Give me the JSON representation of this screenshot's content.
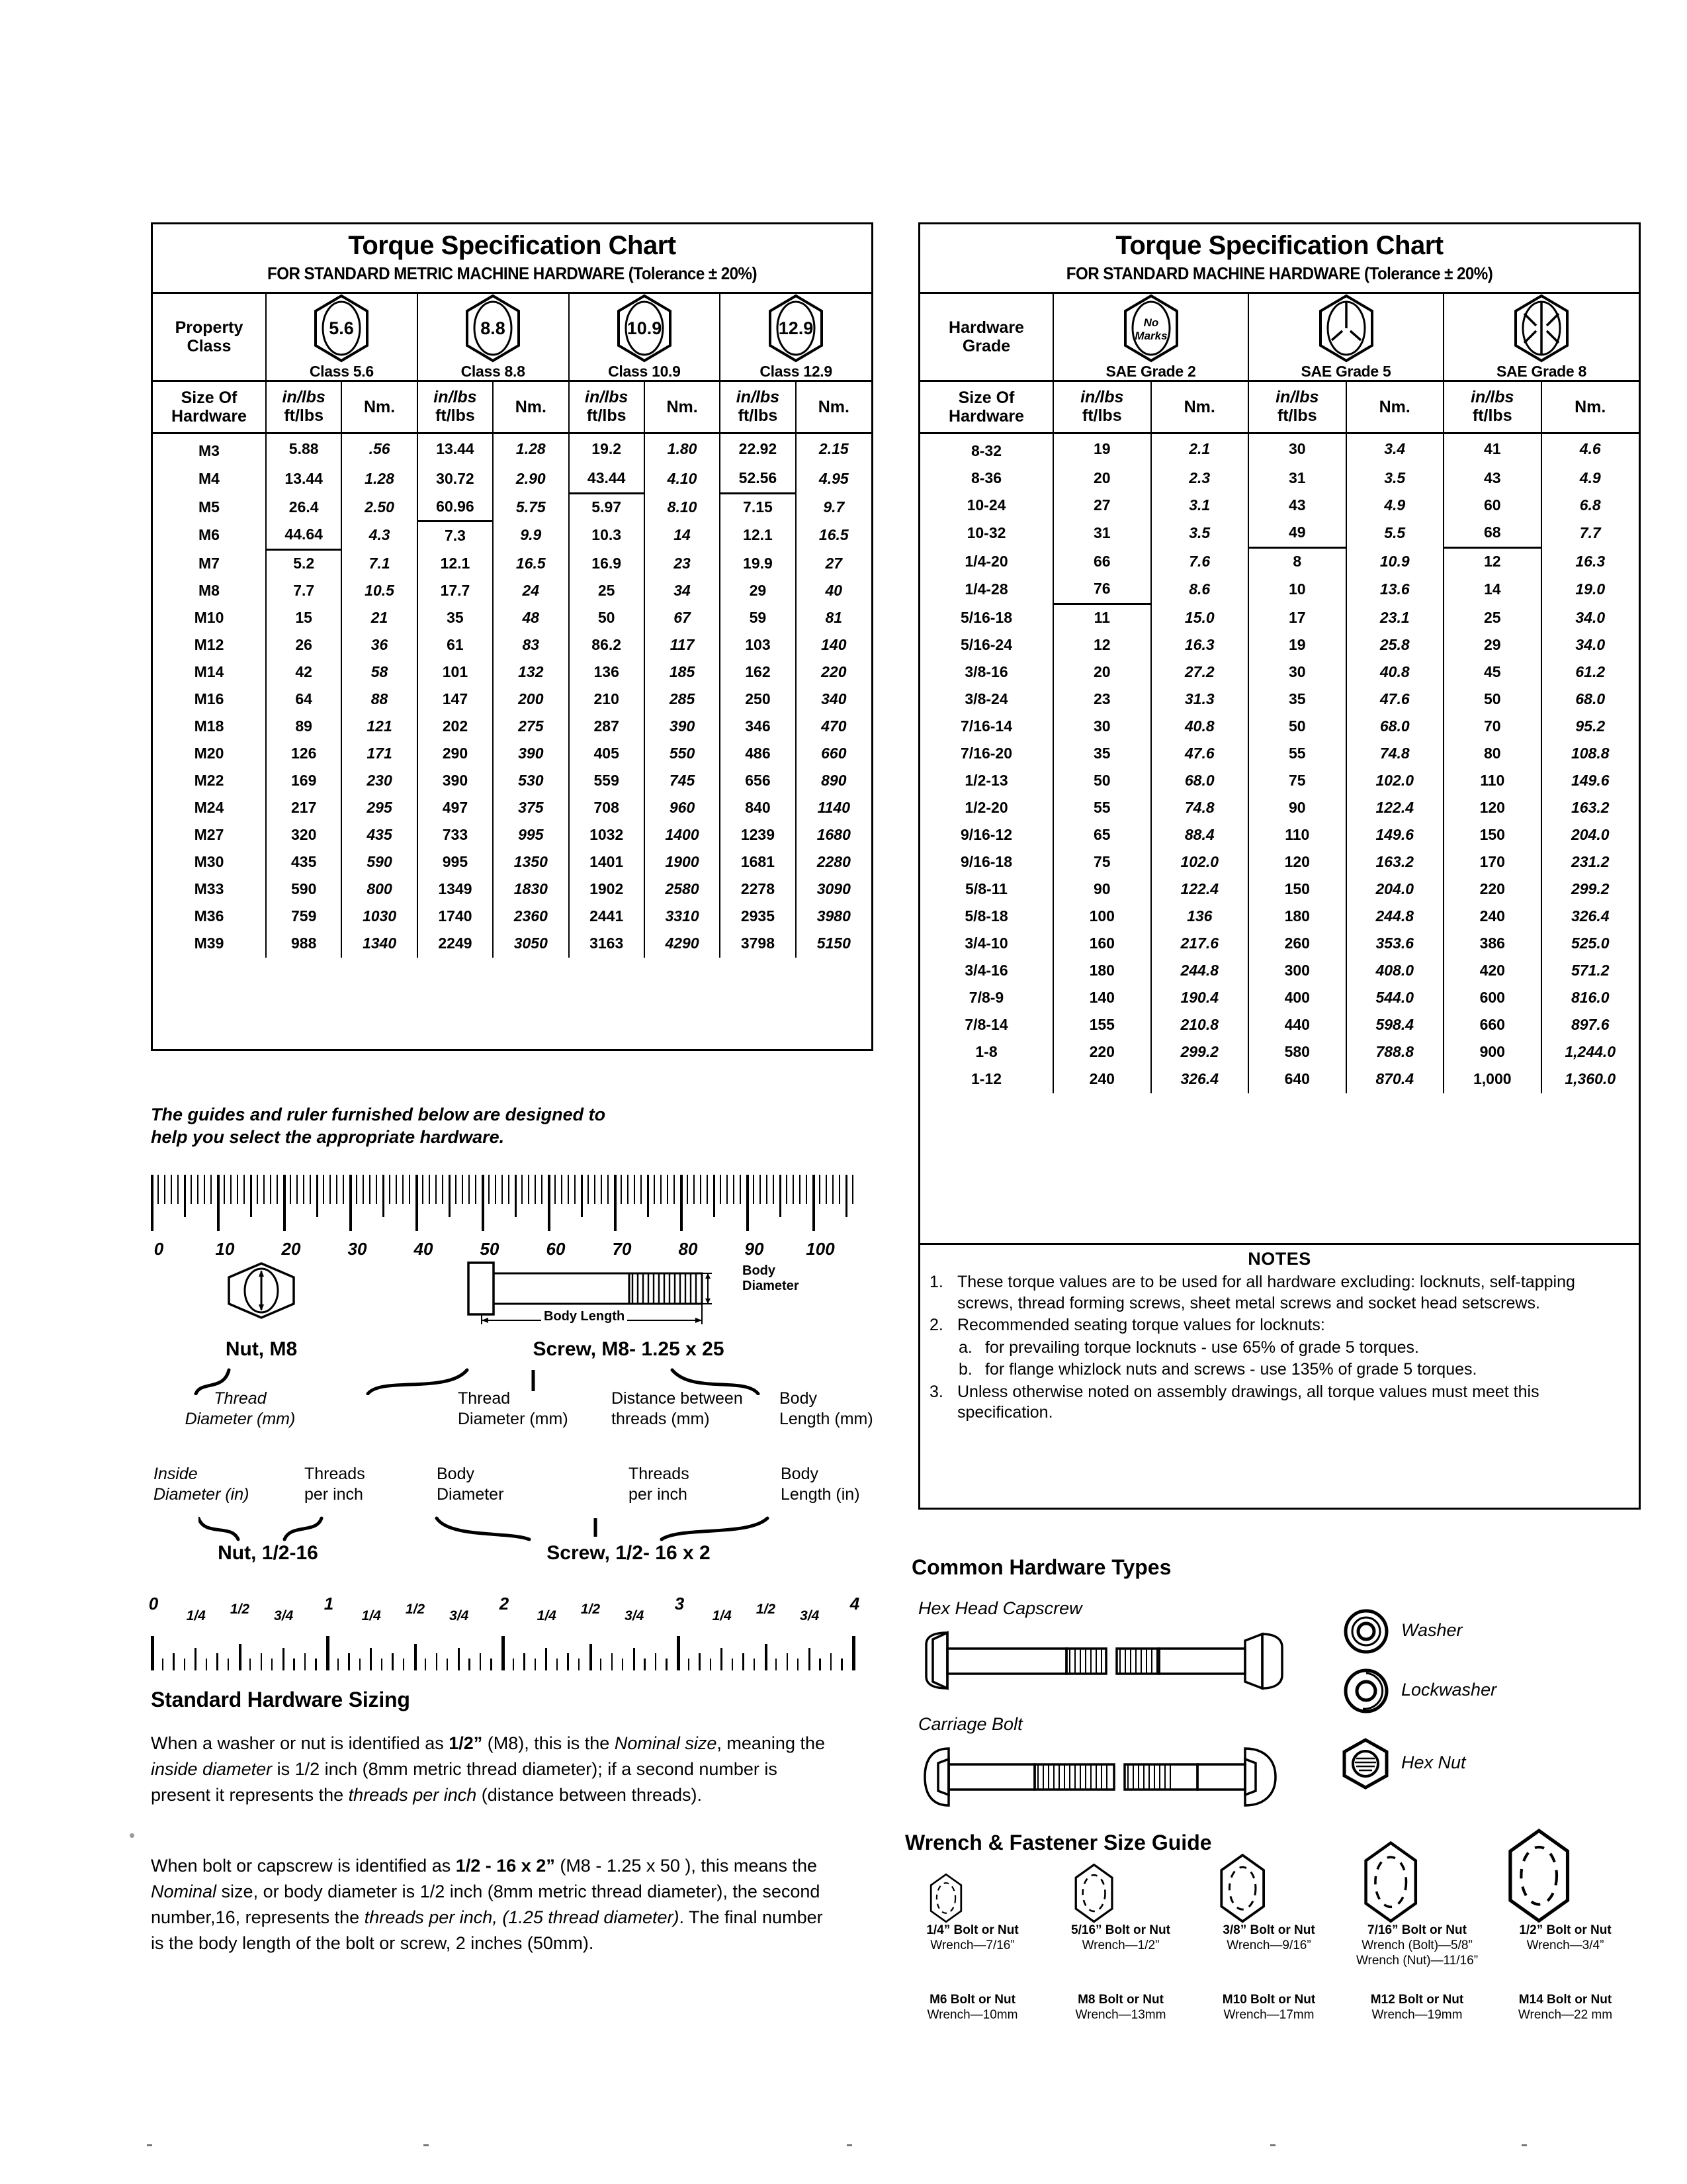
{
  "metric_chart": {
    "title": "Torque Specification Chart",
    "subtitle": "FOR STANDARD METRIC MACHINE HARDWARE (Tolerance ± 20%)",
    "grade_row_label_line1": "Property",
    "grade_row_label_line2": "Class",
    "size_label_line1": "Size Of",
    "size_label_line2": "Hardware",
    "unit_top": "in/lbs",
    "unit_bottom": "ft/lbs",
    "unit_nm": "Nm.",
    "classes": [
      {
        "mark": "5.6",
        "label": "Class 5.6"
      },
      {
        "mark": "8.8",
        "label": "Class 8.8"
      },
      {
        "mark": "10.9",
        "label": "Class 10.9"
      },
      {
        "mark": "12.9",
        "label": "Class 12.9"
      }
    ],
    "rows": [
      {
        "size": "M3",
        "v": [
          "5.88",
          ".56",
          "13.44",
          "1.28",
          "19.2",
          "1.80",
          "22.92",
          "2.15"
        ]
      },
      {
        "size": "M4",
        "v": [
          "13.44",
          "1.28",
          "30.72",
          "2.90",
          "43.44",
          "4.10",
          "52.56",
          "4.95"
        ]
      },
      {
        "size": "M5",
        "v": [
          "26.4",
          "2.50",
          "60.96",
          "5.75",
          "5.97",
          "8.10",
          "7.15",
          "9.7"
        ]
      },
      {
        "size": "M6",
        "v": [
          "44.64",
          "4.3",
          "7.3",
          "9.9",
          "10.3",
          "14",
          "12.1",
          "16.5"
        ]
      },
      {
        "size": "M7",
        "v": [
          "5.2",
          "7.1",
          "12.1",
          "16.5",
          "16.9",
          "23",
          "19.9",
          "27"
        ]
      },
      {
        "size": "M8",
        "v": [
          "7.7",
          "10.5",
          "17.7",
          "24",
          "25",
          "34",
          "29",
          "40"
        ]
      },
      {
        "size": "M10",
        "v": [
          "15",
          "21",
          "35",
          "48",
          "50",
          "67",
          "59",
          "81"
        ]
      },
      {
        "size": "M12",
        "v": [
          "26",
          "36",
          "61",
          "83",
          "86.2",
          "117",
          "103",
          "140"
        ]
      },
      {
        "size": "M14",
        "v": [
          "42",
          "58",
          "101",
          "132",
          "136",
          "185",
          "162",
          "220"
        ]
      },
      {
        "size": "M16",
        "v": [
          "64",
          "88",
          "147",
          "200",
          "210",
          "285",
          "250",
          "340"
        ]
      },
      {
        "size": "M18",
        "v": [
          "89",
          "121",
          "202",
          "275",
          "287",
          "390",
          "346",
          "470"
        ]
      },
      {
        "size": "M20",
        "v": [
          "126",
          "171",
          "290",
          "390",
          "405",
          "550",
          "486",
          "660"
        ]
      },
      {
        "size": "M22",
        "v": [
          "169",
          "230",
          "390",
          "530",
          "559",
          "745",
          "656",
          "890"
        ]
      },
      {
        "size": "M24",
        "v": [
          "217",
          "295",
          "497",
          "375",
          "708",
          "960",
          "840",
          "1140"
        ]
      },
      {
        "size": "M27",
        "v": [
          "320",
          "435",
          "733",
          "995",
          "1032",
          "1400",
          "1239",
          "1680"
        ]
      },
      {
        "size": "M30",
        "v": [
          "435",
          "590",
          "995",
          "1350",
          "1401",
          "1900",
          "1681",
          "2280"
        ]
      },
      {
        "size": "M33",
        "v": [
          "590",
          "800",
          "1349",
          "1830",
          "1902",
          "2580",
          "2278",
          "3090"
        ]
      },
      {
        "size": "M36",
        "v": [
          "759",
          "1030",
          "1740",
          "2360",
          "2441",
          "3310",
          "2935",
          "3980"
        ]
      },
      {
        "size": "M39",
        "v": [
          "988",
          "1340",
          "2249",
          "3050",
          "3163",
          "4290",
          "3798",
          "5150"
        ]
      }
    ],
    "unit_break_after_row": [
      3,
      2,
      1,
      1
    ]
  },
  "sae_chart": {
    "title": "Torque Specification Chart",
    "subtitle": "FOR STANDARD MACHINE HARDWARE (Tolerance ± 20%)",
    "grade_row_label_line1": "Hardware",
    "grade_row_label_line2": "Grade",
    "size_label_line1": "Size Of",
    "size_label_line2": "Hardware",
    "unit_top": "in/lbs",
    "unit_bottom": "ft/lbs",
    "unit_nm": "Nm.",
    "grades": [
      {
        "mark": "No Marks",
        "label": "SAE Grade 2"
      },
      {
        "mark": "",
        "label": "SAE Grade 5"
      },
      {
        "mark": "",
        "label": "SAE Grade 8"
      }
    ],
    "rows": [
      {
        "size": "8-32",
        "v": [
          "19",
          "2.1",
          "30",
          "3.4",
          "41",
          "4.6"
        ]
      },
      {
        "size": "8-36",
        "v": [
          "20",
          "2.3",
          "31",
          "3.5",
          "43",
          "4.9"
        ]
      },
      {
        "size": "10-24",
        "v": [
          "27",
          "3.1",
          "43",
          "4.9",
          "60",
          "6.8"
        ]
      },
      {
        "size": "10-32",
        "v": [
          "31",
          "3.5",
          "49",
          "5.5",
          "68",
          "7.7"
        ]
      },
      {
        "size": "1/4-20",
        "v": [
          "66",
          "7.6",
          "8",
          "10.9",
          "12",
          "16.3"
        ]
      },
      {
        "size": "1/4-28",
        "v": [
          "76",
          "8.6",
          "10",
          "13.6",
          "14",
          "19.0"
        ]
      },
      {
        "size": "5/16-18",
        "v": [
          "11",
          "15.0",
          "17",
          "23.1",
          "25",
          "34.0"
        ]
      },
      {
        "size": "5/16-24",
        "v": [
          "12",
          "16.3",
          "19",
          "25.8",
          "29",
          "34.0"
        ]
      },
      {
        "size": "3/8-16",
        "v": [
          "20",
          "27.2",
          "30",
          "40.8",
          "45",
          "61.2"
        ]
      },
      {
        "size": "3/8-24",
        "v": [
          "23",
          "31.3",
          "35",
          "47.6",
          "50",
          "68.0"
        ]
      },
      {
        "size": "7/16-14",
        "v": [
          "30",
          "40.8",
          "50",
          "68.0",
          "70",
          "95.2"
        ]
      },
      {
        "size": "7/16-20",
        "v": [
          "35",
          "47.6",
          "55",
          "74.8",
          "80",
          "108.8"
        ]
      },
      {
        "size": "1/2-13",
        "v": [
          "50",
          "68.0",
          "75",
          "102.0",
          "110",
          "149.6"
        ]
      },
      {
        "size": "1/2-20",
        "v": [
          "55",
          "74.8",
          "90",
          "122.4",
          "120",
          "163.2"
        ]
      },
      {
        "size": "9/16-12",
        "v": [
          "65",
          "88.4",
          "110",
          "149.6",
          "150",
          "204.0"
        ]
      },
      {
        "size": "9/16-18",
        "v": [
          "75",
          "102.0",
          "120",
          "163.2",
          "170",
          "231.2"
        ]
      },
      {
        "size": "5/8-11",
        "v": [
          "90",
          "122.4",
          "150",
          "204.0",
          "220",
          "299.2"
        ]
      },
      {
        "size": "5/8-18",
        "v": [
          "100",
          "136",
          "180",
          "244.8",
          "240",
          "326.4"
        ]
      },
      {
        "size": "3/4-10",
        "v": [
          "160",
          "217.6",
          "260",
          "353.6",
          "386",
          "525.0"
        ]
      },
      {
        "size": "3/4-16",
        "v": [
          "180",
          "244.8",
          "300",
          "408.0",
          "420",
          "571.2"
        ]
      },
      {
        "size": "7/8-9",
        "v": [
          "140",
          "190.4",
          "400",
          "544.0",
          "600",
          "816.0"
        ]
      },
      {
        "size": "7/8-14",
        "v": [
          "155",
          "210.8",
          "440",
          "598.4",
          "660",
          "897.6"
        ]
      },
      {
        "size": "1-8",
        "v": [
          "220",
          "299.2",
          "580",
          "788.8",
          "900",
          "1,244.0"
        ]
      },
      {
        "size": "1-12",
        "v": [
          "240",
          "326.4",
          "640",
          "870.4",
          "1,000",
          "1,360.0"
        ]
      }
    ],
    "unit_break_after_row": [
      5,
      3,
      3
    ]
  },
  "notes": {
    "heading": "NOTES",
    "items": [
      {
        "num": "1.",
        "text": "These torque values are to be used for all hardware excluding: locknuts, self-tapping screws, thread forming screws, sheet metal screws and socket head setscrews.",
        "subs": []
      },
      {
        "num": "2.",
        "text": "Recommended seating torque values for locknuts:",
        "subs": [
          {
            "num": "a.",
            "text": "for prevailing torque locknuts - use 65% of grade 5 torques."
          },
          {
            "num": "b.",
            "text": "for flange whizlock nuts and screws - use 135% of grade 5 torques."
          }
        ]
      },
      {
        "num": "3.",
        "text": "Unless otherwise noted on assembly drawings, all torque values must meet this specification.",
        "subs": []
      }
    ]
  },
  "guides": {
    "lead_line1": "The guides and ruler furnished below are designed to",
    "lead_line2": "help you select the appropriate hardware.",
    "mm_ruler_labels": [
      "0",
      "10",
      "20",
      "30",
      "40",
      "50",
      "60",
      "70",
      "80",
      "90",
      "100"
    ],
    "nut_metric_label": "Nut, M8",
    "screw_metric_label": "Screw, M8- 1.25 x 25",
    "nut_imperial_label": "Nut, 1/2-16",
    "screw_imperial_label": "Screw, 1/2- 16 x 2",
    "body_diameter_callout_line1": "Body",
    "body_diameter_callout_line2": "Diameter",
    "body_length_callout": "Body Length",
    "metric_legend": {
      "nut": [
        "Thread",
        "Diameter (mm)"
      ],
      "screw_thread": [
        "Thread",
        "Diameter (mm)"
      ],
      "screw_pitch": [
        "Distance between",
        "threads (mm)"
      ],
      "screw_length": [
        "Body",
        "Length (mm)"
      ]
    },
    "imperial_legend": {
      "nut_id": [
        "Inside",
        "Diameter (in)"
      ],
      "nut_tpi": [
        "Threads",
        "per inch"
      ],
      "screw_dia": [
        "Body",
        "Diameter"
      ],
      "screw_tpi": [
        "Threads",
        "per inch"
      ],
      "screw_len": [
        "Body",
        "Length (in)"
      ]
    },
    "inch_ruler_whole": [
      "0",
      "1",
      "2",
      "3",
      "4"
    ],
    "inch_ruler_fractions": [
      "1/4",
      "1/2",
      "3/4"
    ]
  },
  "sizing": {
    "heading": "Standard Hardware Sizing",
    "p1_parts": [
      {
        "t": "When a washer or nut is identified as ",
        "s": "n"
      },
      {
        "t": "1/2”",
        "s": "b"
      },
      {
        "t": " (M8), this is the ",
        "s": "n"
      },
      {
        "t": "Nominal size",
        "s": "i"
      },
      {
        "t": ", meaning the ",
        "s": "n"
      },
      {
        "t": "inside diameter",
        "s": "i"
      },
      {
        "t": " is 1/2 inch (8mm metric thread diameter); if a second number is present it represents the ",
        "s": "n"
      },
      {
        "t": "threads per inch",
        "s": "i"
      },
      {
        "t": " (distance between threads).",
        "s": "n"
      }
    ],
    "p2_parts": [
      {
        "t": "When bolt or capscrew is identified as ",
        "s": "n"
      },
      {
        "t": "1/2 - 16 x 2”",
        "s": "b"
      },
      {
        "t": " (M8 - 1.25 x 50 ), this means the ",
        "s": "n"
      },
      {
        "t": "Nominal",
        "s": "i"
      },
      {
        "t": " size, or body diameter is 1/2 inch (8mm metric thread diameter), the second number,16, represents the ",
        "s": "n"
      },
      {
        "t": "threads per inch, (1.25 thread diameter)",
        "s": "i"
      },
      {
        "t": ". The final number is the body length of the bolt or screw, 2 inches (50mm).",
        "s": "n"
      }
    ]
  },
  "hardware_types": {
    "heading": "Common Hardware Types",
    "left_items": [
      {
        "label": "Hex Head Capscrew"
      },
      {
        "label": "Carriage Bolt"
      }
    ],
    "right_items": [
      {
        "label": "Washer"
      },
      {
        "label": "Lockwasher"
      },
      {
        "label": "Hex Nut"
      }
    ]
  },
  "wrench_guide": {
    "heading": "Wrench & Fastener Size Guide",
    "imperial": [
      {
        "size": "1/4” Bolt or Nut",
        "wrench": "Wrench—7/16”",
        "wrench2": ""
      },
      {
        "size": "5/16” Bolt or Nut",
        "wrench": "Wrench—1/2”",
        "wrench2": ""
      },
      {
        "size": "3/8” Bolt or Nut",
        "wrench": "Wrench—9/16”",
        "wrench2": ""
      },
      {
        "size": "7/16” Bolt or Nut",
        "wrench": "Wrench (Bolt)—5/8”",
        "wrench2": "Wrench (Nut)—11/16”"
      },
      {
        "size": "1/2” Bolt or Nut",
        "wrench": "Wrench—3/4”",
        "wrench2": ""
      }
    ],
    "metric": [
      {
        "size": "M6 Bolt or Nut",
        "wrench": "Wrench—10mm"
      },
      {
        "size": "M8 Bolt or Nut",
        "wrench": "Wrench—13mm"
      },
      {
        "size": "M10 Bolt or Nut",
        "wrench": "Wrench—17mm"
      },
      {
        "size": "M12 Bolt or Nut",
        "wrench": "Wrench—19mm"
      },
      {
        "size": "M14 Bolt or Nut",
        "wrench": "Wrench—22 mm"
      }
    ]
  }
}
